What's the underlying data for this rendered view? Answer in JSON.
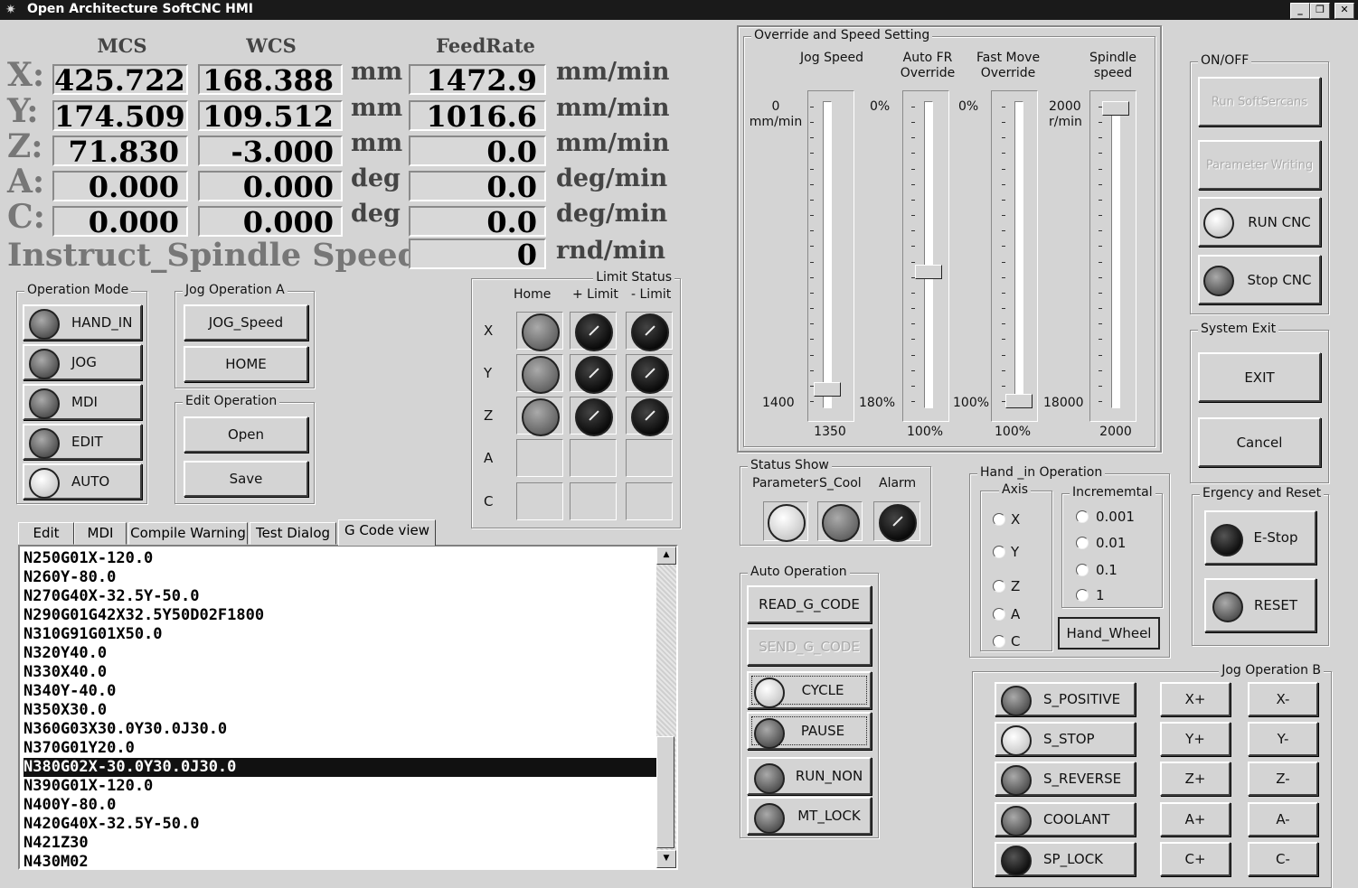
{
  "window": {
    "title": "Open Architecture SoftCNC HMI"
  },
  "coords": {
    "headers": {
      "mcs": "MCS",
      "wcs": "WCS",
      "feed": "FeedRate"
    },
    "rows": [
      {
        "axis": "X:",
        "mcs": "425.722",
        "wcs": "168.388",
        "unit": "mm",
        "feed": "1472.9",
        "feed_unit": "mm/min"
      },
      {
        "axis": "Y:",
        "mcs": "174.509",
        "wcs": "109.512",
        "unit": "mm",
        "feed": "1016.6",
        "feed_unit": "mm/min"
      },
      {
        "axis": "Z:",
        "mcs": "71.830",
        "wcs": "-3.000",
        "unit": "mm",
        "feed": "0.0",
        "feed_unit": "mm/min"
      },
      {
        "axis": "A:",
        "mcs": "0.000",
        "wcs": "0.000",
        "unit": "deg",
        "feed": "0.0",
        "feed_unit": "deg/min"
      },
      {
        "axis": "C:",
        "mcs": "0.000",
        "wcs": "0.000",
        "unit": "deg",
        "feed": "0.0",
        "feed_unit": "deg/min"
      }
    ],
    "spindle": {
      "label": "Instruct_Spindle Speed:",
      "value": "0",
      "unit": "rnd/min"
    }
  },
  "operation_mode": {
    "title": "Operation Mode",
    "items": [
      "HAND_IN",
      "JOG",
      "MDI",
      "EDIT",
      "AUTO"
    ]
  },
  "jog_a": {
    "title": "Jog Operation A",
    "items": [
      "JOG_Speed",
      "HOME"
    ]
  },
  "edit_op": {
    "title": "Edit Operation",
    "items": [
      "Open",
      "Save"
    ]
  },
  "limit_status": {
    "title": "Limit Status",
    "cols": [
      "Home",
      "+ Limit",
      "- Limit"
    ],
    "rows": [
      "X",
      "Y",
      "Z",
      "A",
      "C"
    ]
  },
  "tabs": [
    "Edit",
    "MDI",
    "Compile Warning",
    "Test Dialog",
    "G Code view"
  ],
  "gcode": {
    "lines": [
      "N250G01X-120.0",
      "N260Y-80.0",
      "N270G40X-32.5Y-50.0",
      "N290G01G42X32.5Y50D02F1800",
      "N310G91G01X50.0",
      "N320Y40.0",
      "N330X40.0",
      "N340Y-40.0",
      "N350X30.0",
      "N360G03X30.0Y30.0J30.0",
      "N370G01Y20.0",
      "N380G02X-30.0Y30.0J30.0",
      "N390G01X-120.0",
      "N400Y-80.0",
      "N420G40X-32.5Y-50.0",
      "N421Z30",
      "N430M02"
    ],
    "selected_index": 11
  },
  "override": {
    "title": "Override and Speed  Setting",
    "sliders": [
      {
        "label1": "Jog Speed",
        "label2": "",
        "top": "0",
        "top2": "mm/min",
        "bottom": "1400",
        "value": "1350",
        "level": 0.96
      },
      {
        "label1": "Auto FR",
        "label2": "Override",
        "top": "0%",
        "top2": "",
        "bottom": "180%",
        "value": "100%",
        "level": 0.56
      },
      {
        "label1": "Fast Move",
        "label2": "Override",
        "top": "0%",
        "top2": "",
        "bottom": "100%",
        "value": "100%",
        "level": 1.0
      },
      {
        "label1": "Spindle",
        "label2": "speed",
        "top": "2000",
        "top2": "r/min",
        "bottom": "18000",
        "value": "2000",
        "level": 0.0
      }
    ]
  },
  "onoff": {
    "title": "ON/OFF",
    "run_softsercans": "Run SoftSercans",
    "param_writing": "Parameter Writing",
    "run_cnc": "RUN CNC",
    "stop_cnc": "Stop CNC"
  },
  "system_exit": {
    "title": "System Exit",
    "exit": "EXIT",
    "cancel": "Cancel"
  },
  "status_show": {
    "title": "Status Show",
    "labels": [
      "Parameter",
      "S_Cool",
      "Alarm"
    ]
  },
  "auto_op": {
    "title": "Auto Operation",
    "read": "READ_G_CODE",
    "send": "SEND_G_CODE",
    "cycle": "CYCLE",
    "pause": "PAUSE",
    "run_non": "RUN_NON",
    "mt_lock": "MT_LOCK"
  },
  "hand_in": {
    "title": "Hand _in Operation",
    "axis_title": "Axis",
    "axes": [
      "X",
      "Y",
      "Z",
      "A",
      "C"
    ],
    "inc_title": "Incrememtal",
    "incs": [
      "0.001",
      "0.01",
      "0.1",
      "1"
    ],
    "handwheel": "Hand_Wheel"
  },
  "emergency": {
    "title": "Ergency and Reset",
    "estop": "E-Stop",
    "reset": "RESET"
  },
  "jog_b": {
    "title": "Jog Operation B",
    "items": [
      "S_POSITIVE",
      "S_STOP",
      "S_REVERSE",
      "COOLANT",
      "SP_LOCK"
    ],
    "plus": [
      "X+",
      "Y+",
      "Z+",
      "A+",
      "C+"
    ],
    "minus": [
      "X-",
      "Y-",
      "Z-",
      "A-",
      "C-"
    ]
  }
}
